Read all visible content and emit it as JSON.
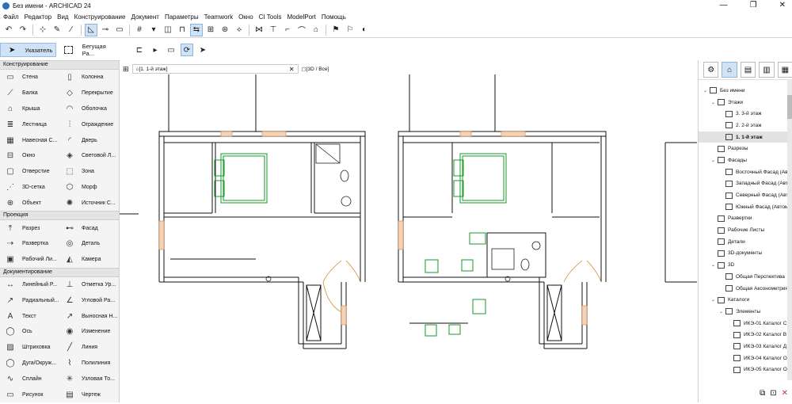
{
  "window": {
    "title": "Без имени - ARCHICAD 24",
    "buttons": [
      "—",
      "❐",
      "✕"
    ]
  },
  "menu": [
    "Файл",
    "Редактор",
    "Вид",
    "Конструирование",
    "Документ",
    "Параметры",
    "Teamwork",
    "Окно",
    "CI Tools",
    "ModelPort",
    "Помощь"
  ],
  "toolbox": {
    "pointer_label": "Указатель",
    "marquee_label": "Бегущая Ра...",
    "sections": [
      {
        "title": "Конструирование",
        "tools": [
          {
            "label": "Стена",
            "icon": "wall-icon"
          },
          {
            "label": "Колонна",
            "icon": "column-icon"
          },
          {
            "label": "Балка",
            "icon": "beam-icon"
          },
          {
            "label": "Перекрытие",
            "icon": "slab-icon"
          },
          {
            "label": "Крыша",
            "icon": "roof-icon"
          },
          {
            "label": "Оболочка",
            "icon": "shell-icon"
          },
          {
            "label": "Лестница",
            "icon": "stair-icon"
          },
          {
            "label": "Ограждение",
            "icon": "railing-icon"
          },
          {
            "label": "Навесная С...",
            "icon": "curtain-wall-icon"
          },
          {
            "label": "Дверь",
            "icon": "door-icon"
          },
          {
            "label": "Окно",
            "icon": "window-icon"
          },
          {
            "label": "Световой Л...",
            "icon": "skylight-icon"
          },
          {
            "label": "Отверстие",
            "icon": "opening-icon"
          },
          {
            "label": "Зона",
            "icon": "zone-icon"
          },
          {
            "label": "3D-сетка",
            "icon": "mesh-icon"
          },
          {
            "label": "Морф",
            "icon": "morph-icon"
          },
          {
            "label": "Объект",
            "icon": "object-icon"
          },
          {
            "label": "Источник С...",
            "icon": "lamp-icon"
          }
        ]
      },
      {
        "title": "Проекция",
        "tools": [
          {
            "label": "Разрез",
            "icon": "section-icon"
          },
          {
            "label": "Фасад",
            "icon": "elevation-icon"
          },
          {
            "label": "Развертка",
            "icon": "interior-elevation-icon"
          },
          {
            "label": "Деталь",
            "icon": "detail-icon"
          },
          {
            "label": "Рабочий Ли...",
            "icon": "worksheet-icon"
          },
          {
            "label": "Камера",
            "icon": "camera-icon"
          }
        ]
      },
      {
        "title": "Документирование",
        "tools": [
          {
            "label": "Линейный Р...",
            "icon": "linear-dimension-icon"
          },
          {
            "label": "Отметка Ур...",
            "icon": "level-dimension-icon"
          },
          {
            "label": "Радиальный...",
            "icon": "radial-dimension-icon"
          },
          {
            "label": "Угловой Ра...",
            "icon": "angle-dimension-icon"
          },
          {
            "label": "Текст",
            "icon": "text-icon"
          },
          {
            "label": "Выносная Н...",
            "icon": "label-icon"
          },
          {
            "label": "Ось",
            "icon": "grid-icon"
          },
          {
            "label": "Изменение",
            "icon": "change-icon"
          },
          {
            "label": "Штриховка",
            "icon": "fill-icon"
          },
          {
            "label": "Линия",
            "icon": "line-icon"
          },
          {
            "label": "Дуга/Окруж...",
            "icon": "arc-icon"
          },
          {
            "label": "Полилиния",
            "icon": "polyline-icon"
          },
          {
            "label": "Сплайн",
            "icon": "spline-icon"
          },
          {
            "label": "Узловая То...",
            "icon": "hotspot-icon"
          },
          {
            "label": "Рисунок",
            "icon": "figure-icon"
          },
          {
            "label": "Чертеж",
            "icon": "drawing-icon"
          }
        ]
      }
    ]
  },
  "tabs": {
    "active": "[1. 1-й этаж]",
    "second": "[3D / Все]"
  },
  "navigator": {
    "items": [
      {
        "label": "Без имени",
        "level": 0,
        "twisty": "⌄"
      },
      {
        "label": "Этажи",
        "level": 1,
        "twisty": "⌄"
      },
      {
        "label": "3. 3-й этаж",
        "level": 2,
        "twisty": ""
      },
      {
        "label": "2. 2-й этаж",
        "level": 2,
        "twisty": ""
      },
      {
        "label": "1. 1-й этаж",
        "level": 2,
        "twisty": "",
        "selected": true
      },
      {
        "label": "Разрезы",
        "level": 1,
        "twisty": ""
      },
      {
        "label": "Фасады",
        "level": 1,
        "twisty": "⌄"
      },
      {
        "label": "Восточный Фасад (Авт",
        "level": 2,
        "twisty": ""
      },
      {
        "label": "Западный Фасад (Авто",
        "level": 2,
        "twisty": ""
      },
      {
        "label": "Северный Фасад (Авто",
        "level": 2,
        "twisty": ""
      },
      {
        "label": "Южный Фасад (Автом",
        "level": 2,
        "twisty": ""
      },
      {
        "label": "Развертки",
        "level": 1,
        "twisty": ""
      },
      {
        "label": "Рабочие Листы",
        "level": 1,
        "twisty": ""
      },
      {
        "label": "Детали",
        "level": 1,
        "twisty": ""
      },
      {
        "label": "3D-документы",
        "level": 1,
        "twisty": ""
      },
      {
        "label": "3D",
        "level": 1,
        "twisty": "⌄"
      },
      {
        "label": "Общая Перспектива",
        "level": 2,
        "twisty": ""
      },
      {
        "label": "Общая Аксонометрия",
        "level": 2,
        "twisty": ""
      },
      {
        "label": "Каталоги",
        "level": 1,
        "twisty": "⌄"
      },
      {
        "label": "Элементы",
        "level": 2,
        "twisty": "⌄"
      },
      {
        "label": "ИКЭ-01 Каталог С",
        "level": 3,
        "twisty": ""
      },
      {
        "label": "ИКЭ-02 Каталог В",
        "level": 3,
        "twisty": ""
      },
      {
        "label": "ИКЭ-03 Каталог Д",
        "level": 3,
        "twisty": ""
      },
      {
        "label": "ИКЭ-04 Каталог О",
        "level": 3,
        "twisty": ""
      },
      {
        "label": "ИКЭ-05 Каталог О",
        "level": 3,
        "twisty": ""
      }
    ]
  },
  "colors": {
    "selection": "#cfe2f6",
    "furniture": "#1a9a2a",
    "door_swing": "#d08a30",
    "wall": "#111111"
  }
}
